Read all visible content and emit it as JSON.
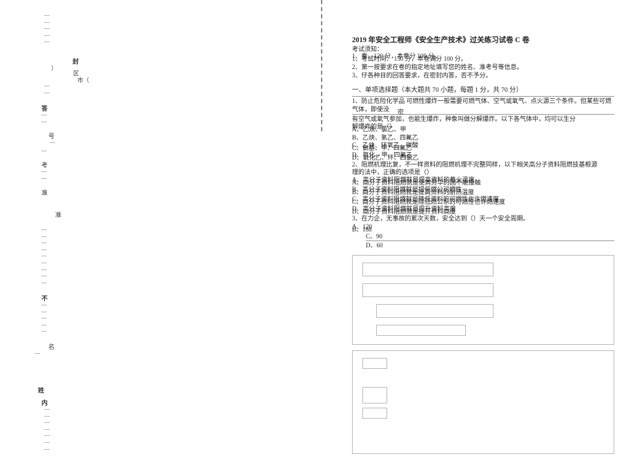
{
  "binding": {
    "seal": "封",
    "qu": "区",
    "shi": "市（",
    "paren": "）",
    "ans": "答",
    "hao": "号",
    "kao": "考",
    "zhun": "准",
    "zhun2": "准",
    "bu": "不",
    "ming": "名",
    "xing": "姓",
    "nei": "内",
    "mi": "密",
    "dots": "...."
  },
  "header": {
    "title": "2019 年安全工程师《安全生产技术》过关练习试卷 C 卷",
    "subhead": "考试须知：",
    "intro1a": "1、考试时间： 150 分，本卷满分 100 分。",
    "intro1b": "1、卷，120 分，本卷分 100 分。",
    "intro2": "2、第一按要求在卷的指定地址填写您的姓名、准考号等信息。",
    "intro3": "3、仔各种目的回答要求，在密封内答，否不予分。"
  },
  "section1_title": "一、单项选择题（本大题共 70 小题，每题 1 分，共 70 分）",
  "q1": {
    "stem1": "1、防止危险化学品 可燃性爆炸一般需要可燃气体、空气或氧气、点火源三个条件。但某些可燃气体，即使没",
    "stem2": "有空气或氧气参加，也能生爆炸，种象叫做分解爆炸。以下各气体中，均可以生分",
    "stem3": "解爆炸的是（）",
    "optA1": "A、乙炔、氯乙、甲",
    "optA2": "A、乙炔、氮、乙",
    "optB": "B、乙炔、氢乙、四氟乙",
    "optC1": "C、乙炔、环氧乙、碳酸",
    "optC2": "C、氨基、甲、四氟乙",
    "optD1": "D、氧化、甲、四氟乙",
    "optD2": "D、氧化乙、环、四氯乙"
  },
  "q2": {
    "stem1": "2、阻燃机理比复，不一样资料的阻燃机理不完整同样，以下相关高分子资料阻燃技基根源",
    "stem2": "理的法中，正确的选项是（）",
    "optA1": "A、高分子资料阻燃就是提高资料的着火温度",
    "optA2": "A、高分子资料阻燃就是使其劳华的固不能接触",
    "optB1": "B、高分子资料阻燃就是提低燃公可燃性",
    "optB2": "B、高分子资料阻燃就是提高资料的耐热温度",
    "optC1": "C、高分子资料阻燃就是降低资料的可燃性也许燃速度",
    "optC2": "C、高分子资料阻燃就是除低燃公系的可燃性也许燃速度",
    "optD1": "D、高分子资料阻燃就是提升资料高度",
    "optD2": "D、高分子资料阻燃就是提开资料高度"
  },
  "q3": {
    "stem": "3、在力企，无事故的累次天数，安全达到（）天一个安全周期。",
    "optA1": "A、120",
    "optB1": "B、100",
    "optB2": "B、188",
    "optC": "C、90",
    "optD": "D、60"
  }
}
